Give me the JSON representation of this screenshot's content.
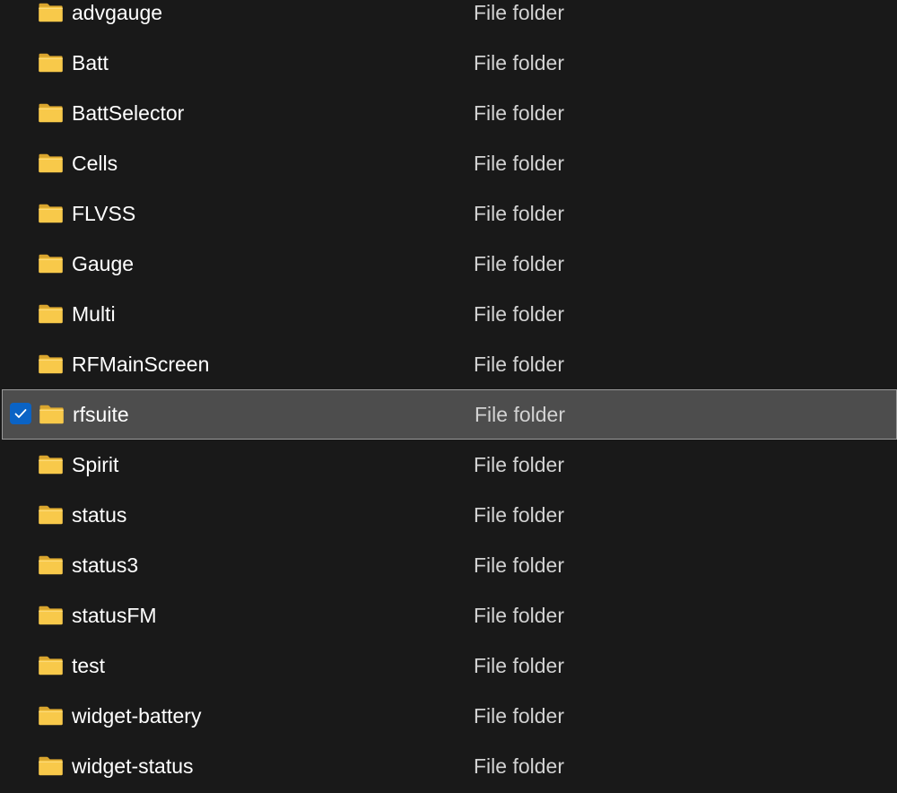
{
  "files": [
    {
      "name": "advgauge",
      "type": "File folder",
      "selected": false
    },
    {
      "name": "Batt",
      "type": "File folder",
      "selected": false
    },
    {
      "name": "BattSelector",
      "type": "File folder",
      "selected": false
    },
    {
      "name": "Cells",
      "type": "File folder",
      "selected": false
    },
    {
      "name": "FLVSS",
      "type": "File folder",
      "selected": false
    },
    {
      "name": "Gauge",
      "type": "File folder",
      "selected": false
    },
    {
      "name": "Multi",
      "type": "File folder",
      "selected": false
    },
    {
      "name": "RFMainScreen",
      "type": "File folder",
      "selected": false
    },
    {
      "name": "rfsuite",
      "type": "File folder",
      "selected": true
    },
    {
      "name": "Spirit",
      "type": "File folder",
      "selected": false
    },
    {
      "name": "status",
      "type": "File folder",
      "selected": false
    },
    {
      "name": "status3",
      "type": "File folder",
      "selected": false
    },
    {
      "name": "statusFM",
      "type": "File folder",
      "selected": false
    },
    {
      "name": "test",
      "type": "File folder",
      "selected": false
    },
    {
      "name": "widget-battery",
      "type": "File folder",
      "selected": false
    },
    {
      "name": "widget-status",
      "type": "File folder",
      "selected": false
    }
  ],
  "icons": {
    "folder": "folder-icon",
    "checkbox": "checkmark-icon"
  },
  "colors": {
    "background": "#191919",
    "selection": "#4d4d4d",
    "selection_border": "#9a9a9a",
    "checkbox_accent": "#0a63c5",
    "folder_yellow": "#f8c94a"
  }
}
